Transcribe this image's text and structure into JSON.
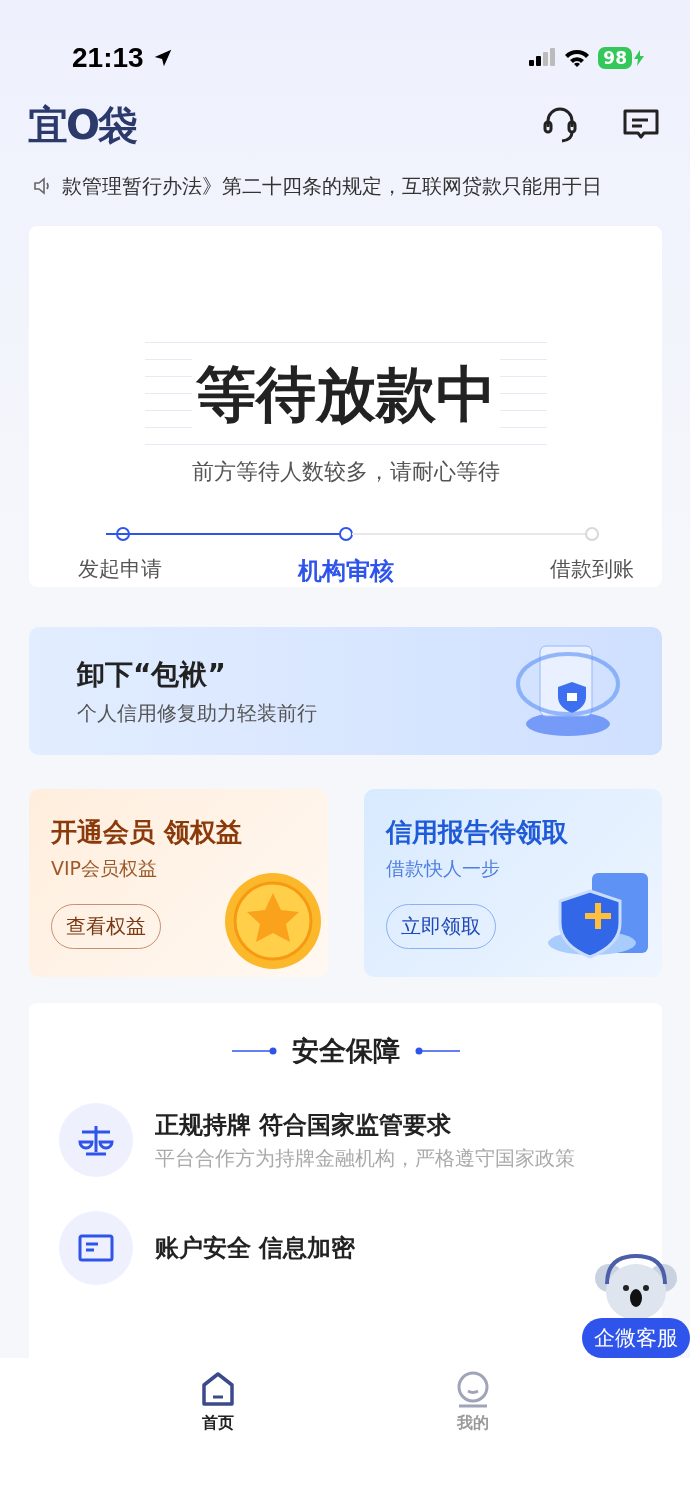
{
  "status_bar": {
    "time": "21:13",
    "battery": "98"
  },
  "header": {
    "logo": "宜O袋"
  },
  "notice": "款管理暂行办法》第二十四条的规定，互联网贷款只能用于日",
  "status_card": {
    "title": "等待放款中",
    "subtitle": "前方等待人数较多，请耐心等待",
    "steps": [
      {
        "label": "发起申请",
        "kind": "done"
      },
      {
        "label": "机构审核",
        "kind": "current"
      },
      {
        "label": "借款到账",
        "kind": "pending"
      }
    ]
  },
  "banner": {
    "title": "卸下“包袱”",
    "subtitle": "个人信用修复助力轻装前行"
  },
  "promo_cards": [
    {
      "kind": "vip",
      "title": "开通会员 领权益",
      "subtitle": "VIP会员权益",
      "button": "查看权益"
    },
    {
      "kind": "report",
      "title": "信用报告待领取",
      "subtitle": "借款快人一步",
      "button": "立即领取"
    }
  ],
  "security": {
    "title": "安全保障",
    "items": [
      {
        "kind": "license",
        "title": "正规持牌 符合国家监管要求",
        "subtitle": "平台合作方为持牌金融机构，严格遵守国家政策"
      },
      {
        "kind": "encrypt",
        "title": "账户安全 信息加密"
      }
    ]
  },
  "support_button": "企微客服",
  "tab_bar": [
    {
      "label": "首页",
      "kind": "home",
      "selected": true
    },
    {
      "label": "我的",
      "kind": "profile",
      "selected": false
    }
  ]
}
